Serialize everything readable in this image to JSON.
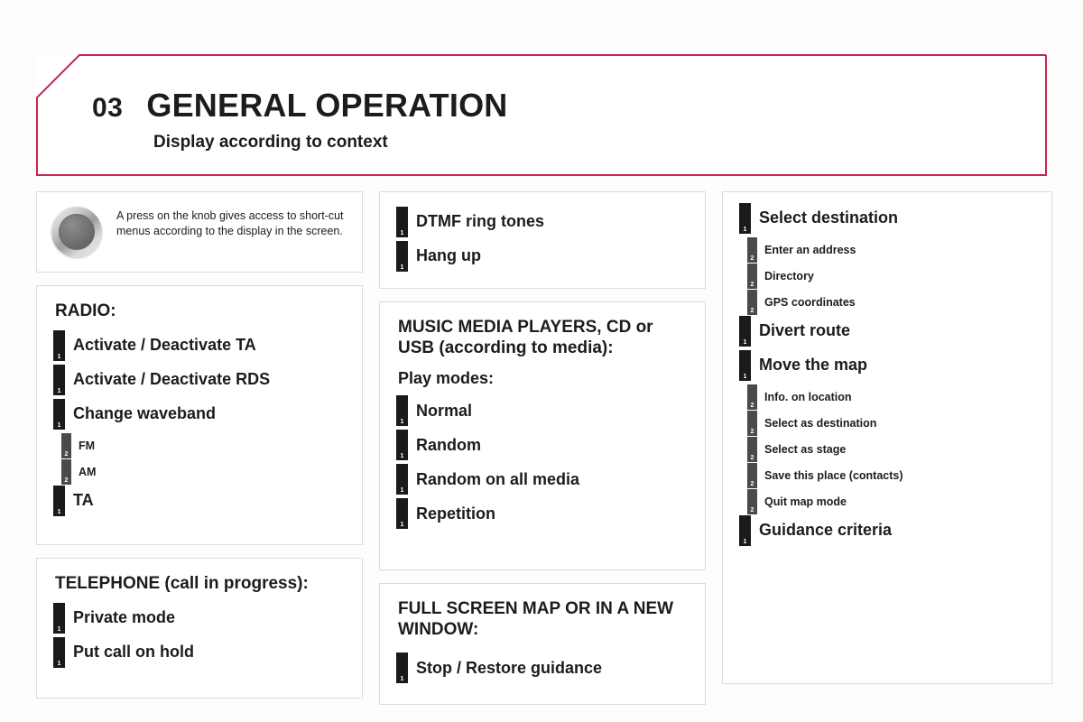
{
  "header": {
    "chapter_number": "03",
    "title": "GENERAL OPERATION",
    "subtitle": "Display according to context",
    "accent_color": "#c9254a"
  },
  "knob_note": {
    "icon": "rotary-knob-icon",
    "text": "A press on the knob gives access to short-cut menus according to the display in the screen."
  },
  "left_column": {
    "radio": {
      "title": "RADIO:",
      "entries": [
        {
          "level": 1,
          "badge": "1",
          "label": "Activate / Deactivate TA"
        },
        {
          "level": 1,
          "badge": "1",
          "label": "Activate / Deactivate RDS"
        },
        {
          "level": 1,
          "badge": "1",
          "label": "Change waveband"
        },
        {
          "level": 2,
          "badge": "2",
          "label": "FM"
        },
        {
          "level": 2,
          "badge": "2",
          "label": "AM"
        },
        {
          "level": 1,
          "badge": "1",
          "label": "TA"
        }
      ]
    },
    "telephone": {
      "title": "TELEPHONE (call in progress):",
      "entries": [
        {
          "level": 1,
          "badge": "1",
          "label": "Private mode"
        },
        {
          "level": 1,
          "badge": "1",
          "label": "Put call on hold"
        }
      ]
    }
  },
  "middle_column": {
    "phone_actions": {
      "entries": [
        {
          "level": 1,
          "badge": "1",
          "label": "DTMF ring tones"
        },
        {
          "level": 1,
          "badge": "1",
          "label": "Hang up"
        }
      ]
    },
    "media": {
      "title": "MUSIC MEDIA PLAYERS, CD or USB (according to media):",
      "subtitle": "Play modes:",
      "entries": [
        {
          "level": 1,
          "badge": "1",
          "label": "Normal"
        },
        {
          "level": 1,
          "badge": "1",
          "label": "Random"
        },
        {
          "level": 1,
          "badge": "1",
          "label": "Random on all media"
        },
        {
          "level": 1,
          "badge": "1",
          "label": "Repetition"
        }
      ]
    },
    "map": {
      "title": "FULL SCREEN MAP OR IN A NEW WINDOW:",
      "entries": [
        {
          "level": 1,
          "badge": "1",
          "label": "Stop / Restore guidance"
        }
      ]
    }
  },
  "right_column": {
    "navigation": {
      "entries": [
        {
          "level": 1,
          "badge": "1",
          "label": "Select destination"
        },
        {
          "level": 2,
          "badge": "2",
          "label": "Enter an address"
        },
        {
          "level": 2,
          "badge": "2",
          "label": "Directory"
        },
        {
          "level": 2,
          "badge": "2",
          "label": "GPS coordinates"
        },
        {
          "level": 1,
          "badge": "1",
          "label": "Divert route"
        },
        {
          "level": 1,
          "badge": "1",
          "label": "Move the map"
        },
        {
          "level": 2,
          "badge": "2",
          "label": "Info. on location"
        },
        {
          "level": 2,
          "badge": "2",
          "label": "Select as destination"
        },
        {
          "level": 2,
          "badge": "2",
          "label": "Select as stage"
        },
        {
          "level": 2,
          "badge": "2",
          "label": "Save this place (contacts)"
        },
        {
          "level": 2,
          "badge": "2",
          "label": "Quit map mode"
        },
        {
          "level": 1,
          "badge": "1",
          "label": "Guidance criteria"
        }
      ]
    }
  }
}
